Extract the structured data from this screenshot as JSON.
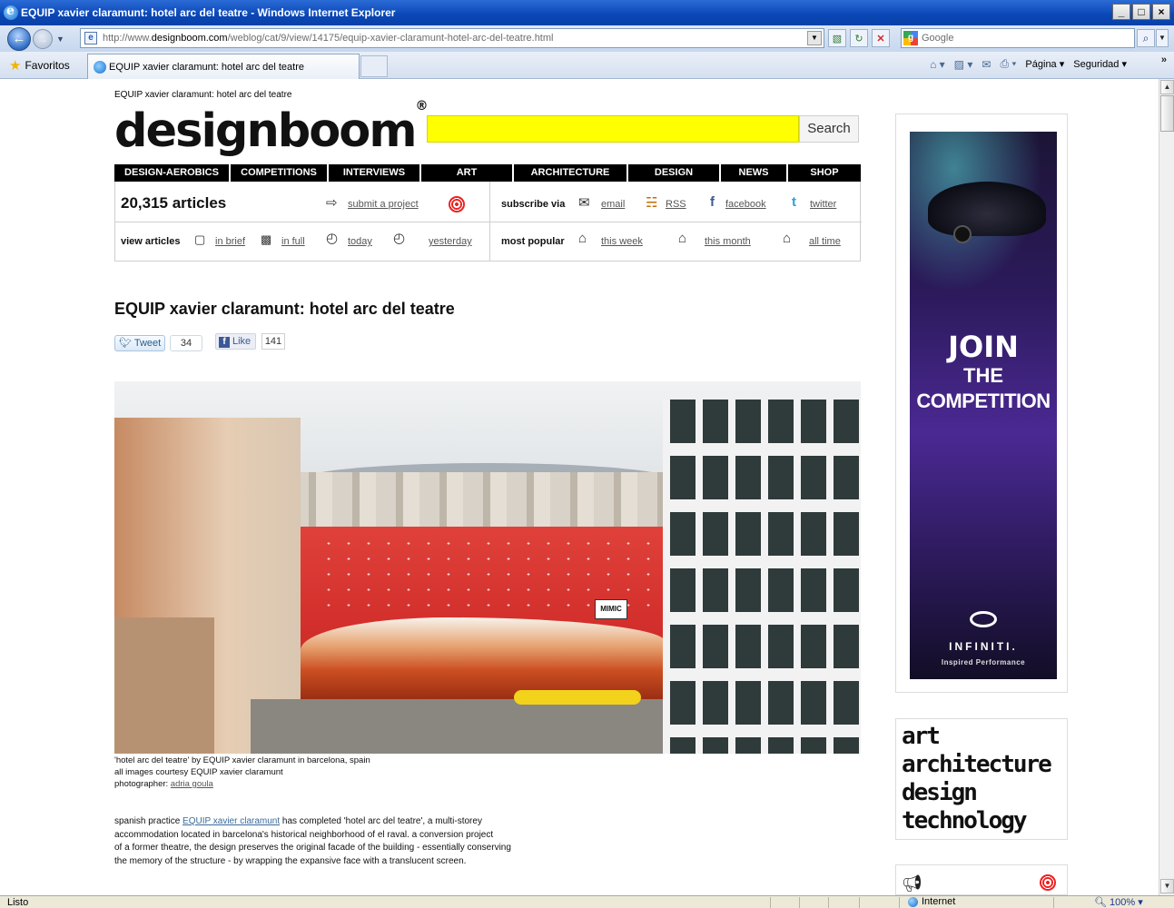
{
  "window": {
    "title": "EQUIP xavier claramunt: hotel arc del teatre - Windows Internet Explorer",
    "controls": [
      "_",
      "□",
      "×"
    ]
  },
  "navbar": {
    "url_prefix": "http://www.",
    "url_host": "designboom.com",
    "url_path": "/weblog/cat/9/view/14175/equip-xavier-claramunt-hotel-arc-del-teatre.html",
    "search_placeholder": "Google"
  },
  "favbar": {
    "favorites_label": "Favoritos",
    "tab_label": "EQUIP xavier claramunt: hotel arc del teatre",
    "page_menu": "Página",
    "safety_menu": "Seguridad",
    "chevron": "»"
  },
  "status": {
    "text": "Listo",
    "zone": "Internet",
    "zoom": "100%"
  },
  "page": {
    "crumb": "EQUIP xavier claramunt: hotel arc del teatre",
    "logo": "designboom",
    "logo_reg": "®",
    "search_button": "Search",
    "menu": [
      "DESIGN-AEROBICS",
      "COMPETITIONS",
      "INTERVIEWS",
      "ART",
      "ARCHITECTURE",
      "DESIGN",
      "NEWS",
      "SHOP"
    ],
    "info": {
      "count": "20,315 articles",
      "submit": "submit a project",
      "subscribe_label": "subscribe via",
      "email": "email",
      "rss": "RSS",
      "facebook": "facebook",
      "twitter": "twitter",
      "view_label": "view articles",
      "in_brief": "in brief",
      "in_full": "in full",
      "today": "today",
      "yesterday": "yesterday",
      "popular_label": "most popular",
      "this_week": "this week",
      "this_month": "this month",
      "all_time": "all time"
    },
    "article": {
      "title": "EQUIP xavier claramunt: hotel arc del teatre",
      "tweet_label": "Tweet",
      "tweet_count": "34",
      "like_label": "Like",
      "like_count": "141",
      "caption_1": "'hotel arc del teatre' by EQUIP xavier claramunt in barcelona, spain",
      "caption_2": "all images courtesy EQUIP xavier claramunt",
      "caption_3_label": "photographer: ",
      "caption_3_link": "adria goula",
      "body_link": "EQUIP xavier claramunt",
      "body_1_pre": "spanish practice ",
      "body_1_post": " has completed 'hotel arc del teatre', a multi-storey",
      "body_2": "accommodation located in barcelona's historical neighborhood of el raval. a conversion project",
      "body_3": "of a former theatre, the design preserves the original facade of the building - essentially conserving",
      "body_4": "the memory of the structure - by wrapping the expansive face with a translucent screen.",
      "photo_sign": "MIMIC"
    },
    "ad": {
      "join": "JOIN",
      "the": "THE",
      "competition": "COMPETITION",
      "brand": "INFINITI.",
      "tagline": "Inspired Performance"
    },
    "words": [
      "art",
      "architecture",
      "design",
      "technology"
    ]
  }
}
